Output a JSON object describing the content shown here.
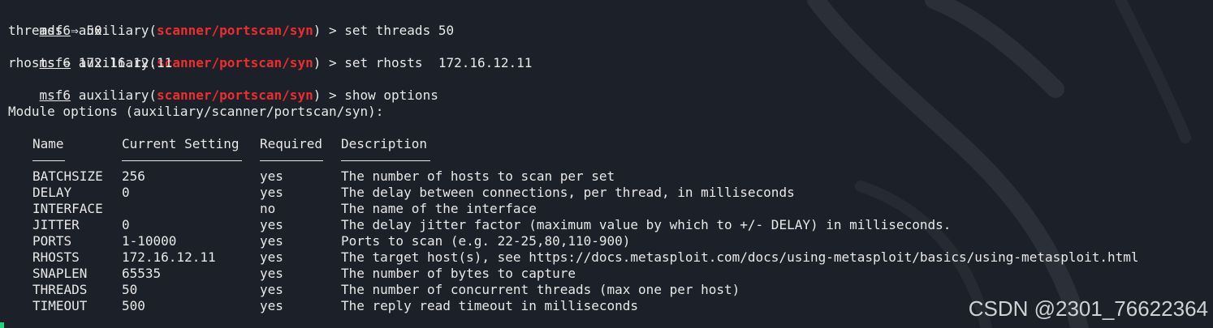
{
  "session": {
    "prompt_prefix": "msf6",
    "module_type": "auxiliary",
    "module_path": "scanner/portscan/syn",
    "commands": [
      {
        "command": "set threads 50",
        "output": "threads ⇒ 50"
      },
      {
        "command": "set rhosts  172.16.12.11",
        "output": "rhosts ⇒ 172.16.12.11"
      },
      {
        "command": "show options",
        "output": ""
      }
    ]
  },
  "options_title": "Module options (auxiliary/scanner/portscan/syn):",
  "table": {
    "headers": [
      "Name",
      "Current Setting",
      "Required",
      "Description"
    ],
    "rows": [
      {
        "name": "BATCHSIZE",
        "current": "256",
        "required": "yes",
        "description": "The number of hosts to scan per set"
      },
      {
        "name": "DELAY",
        "current": "0",
        "required": "yes",
        "description": "The delay between connections, per thread, in milliseconds"
      },
      {
        "name": "INTERFACE",
        "current": "",
        "required": "no",
        "description": "The name of the interface"
      },
      {
        "name": "JITTER",
        "current": "0",
        "required": "yes",
        "description": "The delay jitter factor (maximum value by which to +/- DELAY) in milliseconds."
      },
      {
        "name": "PORTS",
        "current": "1-10000",
        "required": "yes",
        "description": "Ports to scan (e.g. 22-25,80,110-900)"
      },
      {
        "name": "RHOSTS",
        "current": "172.16.12.11",
        "required": "yes",
        "description": "The target host(s), see https://docs.metasploit.com/docs/using-metasploit/basics/using-metasploit.html"
      },
      {
        "name": "SNAPLEN",
        "current": "65535",
        "required": "yes",
        "description": "The number of bytes to capture"
      },
      {
        "name": "THREADS",
        "current": "50",
        "required": "yes",
        "description": "The number of concurrent threads (max one per host)"
      },
      {
        "name": "TIMEOUT",
        "current": "500",
        "required": "yes",
        "description": "The reply read timeout in milliseconds"
      }
    ]
  },
  "watermark": "CSDN @2301_76622364",
  "colors": {
    "background": "#1c2028",
    "text": "#e8e8e8",
    "module_highlight": "#ee2d2d",
    "cursor": "#1fd37a"
  }
}
